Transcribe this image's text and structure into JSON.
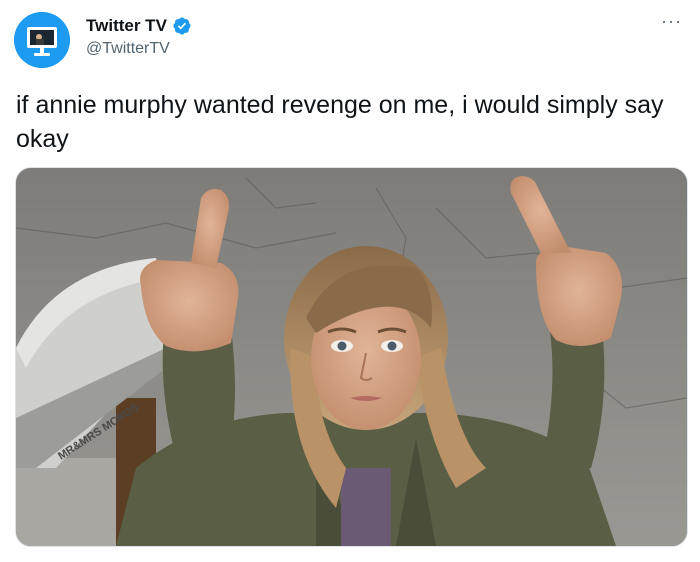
{
  "author": {
    "display_name": "Twitter TV",
    "handle": "@TwitterTV",
    "verified": true,
    "avatar_icon": "tv-monitor-icon"
  },
  "menu": {
    "more_label": "···"
  },
  "tweet": {
    "text": "if annie murphy wanted revenge on me, i would simply say okay"
  },
  "media": {
    "mailbox_text": "MR&MRS MCROS"
  },
  "colors": {
    "accent": "#1d9bf0",
    "text": "#0f1419",
    "secondary": "#536471"
  }
}
